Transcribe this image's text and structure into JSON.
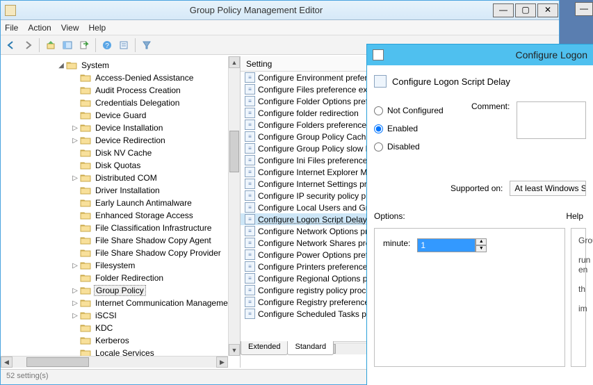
{
  "window": {
    "title": "Group Policy Management Editor",
    "menus": [
      "File",
      "Action",
      "View",
      "Help"
    ],
    "btn_min": "—",
    "btn_max": "▢",
    "btn_close": "✕"
  },
  "status": "52 setting(s)",
  "tree": {
    "root": {
      "label": "System",
      "expanded": true
    },
    "items": [
      {
        "label": "Access-Denied Assistance",
        "twisty": ""
      },
      {
        "label": "Audit Process Creation",
        "twisty": ""
      },
      {
        "label": "Credentials Delegation",
        "twisty": ""
      },
      {
        "label": "Device Guard",
        "twisty": ""
      },
      {
        "label": "Device Installation",
        "twisty": "▷"
      },
      {
        "label": "Device Redirection",
        "twisty": "▷"
      },
      {
        "label": "Disk NV Cache",
        "twisty": ""
      },
      {
        "label": "Disk Quotas",
        "twisty": ""
      },
      {
        "label": "Distributed COM",
        "twisty": "▷"
      },
      {
        "label": "Driver Installation",
        "twisty": ""
      },
      {
        "label": "Early Launch Antimalware",
        "twisty": ""
      },
      {
        "label": "Enhanced Storage Access",
        "twisty": ""
      },
      {
        "label": "File Classification Infrastructure",
        "twisty": ""
      },
      {
        "label": "File Share Shadow Copy Agent",
        "twisty": ""
      },
      {
        "label": "File Share Shadow Copy Provider",
        "twisty": ""
      },
      {
        "label": "Filesystem",
        "twisty": "▷"
      },
      {
        "label": "Folder Redirection",
        "twisty": ""
      },
      {
        "label": "Group Policy",
        "twisty": "▷",
        "selected": true
      },
      {
        "label": "Internet Communication Management",
        "twisty": "▷"
      },
      {
        "label": "iSCSI",
        "twisty": "▷"
      },
      {
        "label": "KDC",
        "twisty": ""
      },
      {
        "label": "Kerberos",
        "twisty": ""
      },
      {
        "label": "Locale Services",
        "twisty": ""
      }
    ]
  },
  "list": {
    "header": "Setting",
    "items": [
      "Configure Environment preferences",
      "Configure Files preference extension",
      "Configure Folder Options preferences",
      "Configure folder redirection",
      "Configure Folders preferences",
      "Configure Group Policy Caching",
      "Configure Group Policy slow link",
      "Configure Ini Files preferences",
      "Configure Internet Explorer Maintenance",
      "Configure Internet Settings preferences",
      "Configure IP security policy processing",
      "Configure Local Users and Groups",
      "Configure Logon Script Delay",
      "Configure Network Options preferences",
      "Configure Network Shares preferences",
      "Configure Power Options preferences",
      "Configure Printers preferences",
      "Configure Regional Options preferences",
      "Configure registry policy processing",
      "Configure Registry preferences",
      "Configure Scheduled Tasks preferences"
    ],
    "selected_index": 12,
    "tabs": {
      "extended": "Extended",
      "standard": "Standard"
    }
  },
  "dialog": {
    "titlebar": "Configure Logon",
    "heading": "Configure Logon Script Delay",
    "radio": {
      "not_configured": "Not Configured",
      "enabled": "Enabled",
      "disabled": "Disabled",
      "selected": "enabled"
    },
    "comment_label": "Comment:",
    "supported_label": "Supported on:",
    "supported_value": "At least Windows Server",
    "options_label": "Options:",
    "help_label": "Help",
    "spin": {
      "label": "minute:",
      "value": "1"
    },
    "help_text": "Group\n\nrun\nen\n\nth\n\nim"
  }
}
